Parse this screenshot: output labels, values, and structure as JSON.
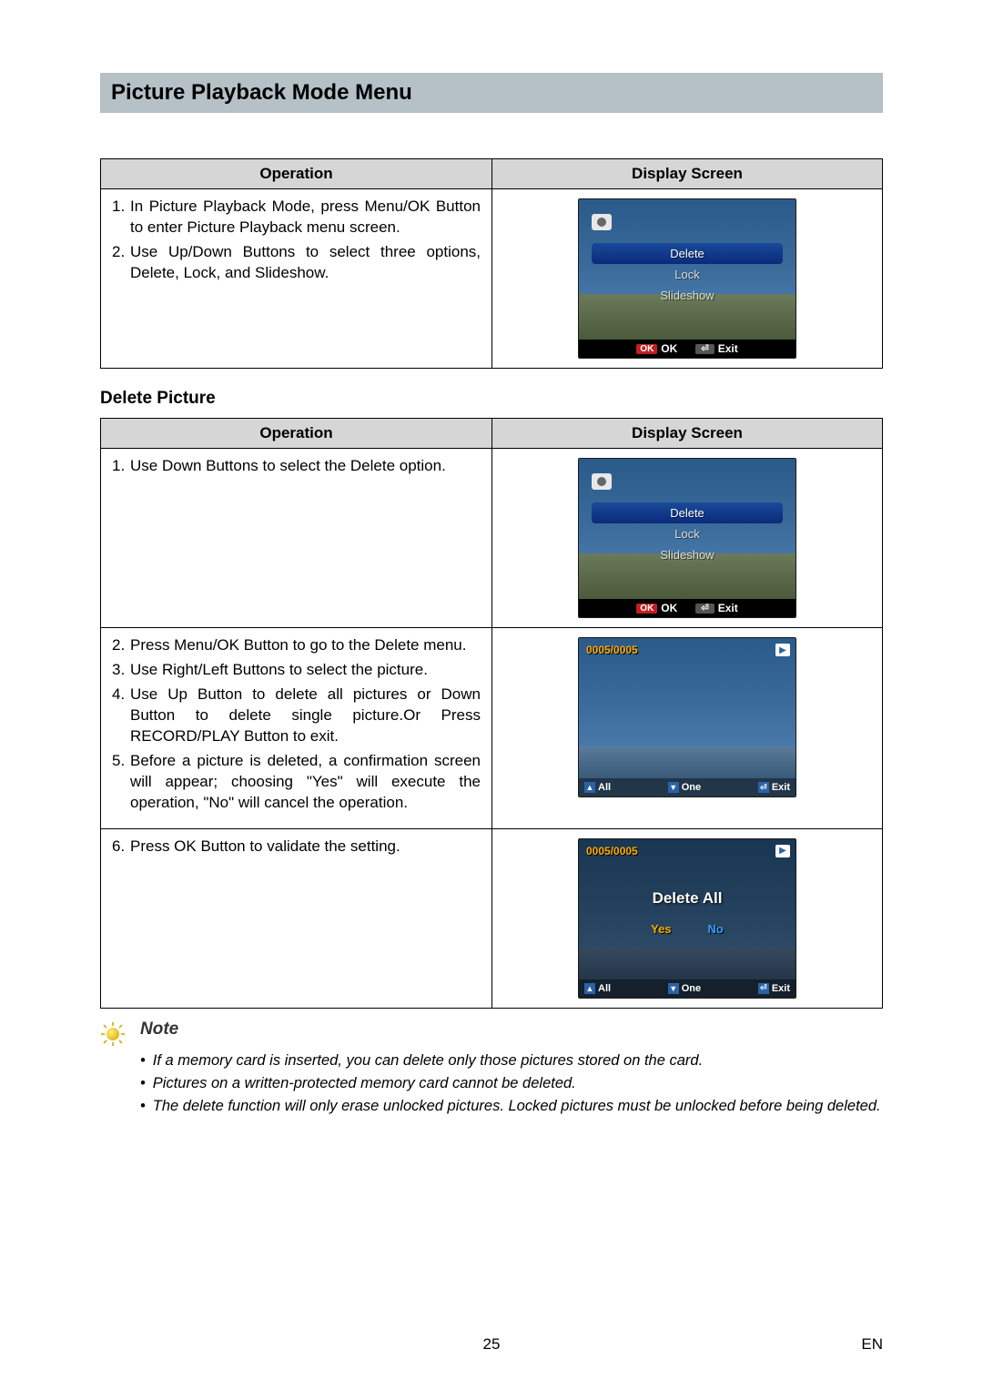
{
  "heading": "Picture Playback Mode Menu",
  "table1": {
    "col_operation": "Operation",
    "col_display": "Display Screen",
    "ops": [
      {
        "n": "1.",
        "t": "In Picture Playback Mode, press Menu/OK Button to enter Picture Playback menu screen."
      },
      {
        "n": "2.",
        "t": "Use Up/Down Buttons to select three options, Delete, Lock, and Slideshow."
      }
    ],
    "lcd": {
      "items": [
        "Delete",
        "Lock",
        "Slideshow"
      ],
      "selected": 0,
      "ok": "OK",
      "exit": "Exit"
    }
  },
  "sub_delete": "Delete Picture",
  "table2": {
    "col_operation": "Operation",
    "col_display": "Display Screen",
    "row1_ops": [
      {
        "n": "1.",
        "t": "Use Down Buttons to select the Delete option."
      }
    ],
    "row1_lcd": {
      "items": [
        "Delete",
        "Lock",
        "Slideshow"
      ],
      "selected": 0,
      "ok": "OK",
      "exit": "Exit"
    },
    "row2_ops": [
      {
        "n": "2.",
        "t": "Press Menu/OK Button to go to the Delete menu."
      },
      {
        "n": "3.",
        "t": "Use Right/Left Buttons to select the picture."
      },
      {
        "n": "4.",
        "t": "Use Up Button to delete all pictures or Down Button to delete single picture.Or Press RECORD/PLAY Button to exit."
      },
      {
        "n": "5.",
        "t": "Before a picture is deleted, a confirmation screen will appear; choosing \"Yes\" will execute the operation, \"No\" will cancel the operation."
      }
    ],
    "row2_lcd": {
      "counter": "0005/0005",
      "all": "All",
      "one": "One",
      "exit": "Exit"
    },
    "row3_ops": [
      {
        "n": "6.",
        "t": "Press OK Button to validate the setting."
      }
    ],
    "row3_lcd": {
      "counter": "0005/0005",
      "dialog_title": "Delete All",
      "yes": "Yes",
      "no": "No",
      "all": "All",
      "one": "One",
      "exit": "Exit"
    }
  },
  "note_title": "Note",
  "notes": [
    "If a memory card is inserted, you can delete only those pictures stored on the card.",
    "Pictures on a written-protected memory card cannot be deleted.",
    "The delete function will only erase unlocked pictures. Locked pictures must be unlocked before being deleted."
  ],
  "page_number": "25",
  "page_lang": "EN"
}
